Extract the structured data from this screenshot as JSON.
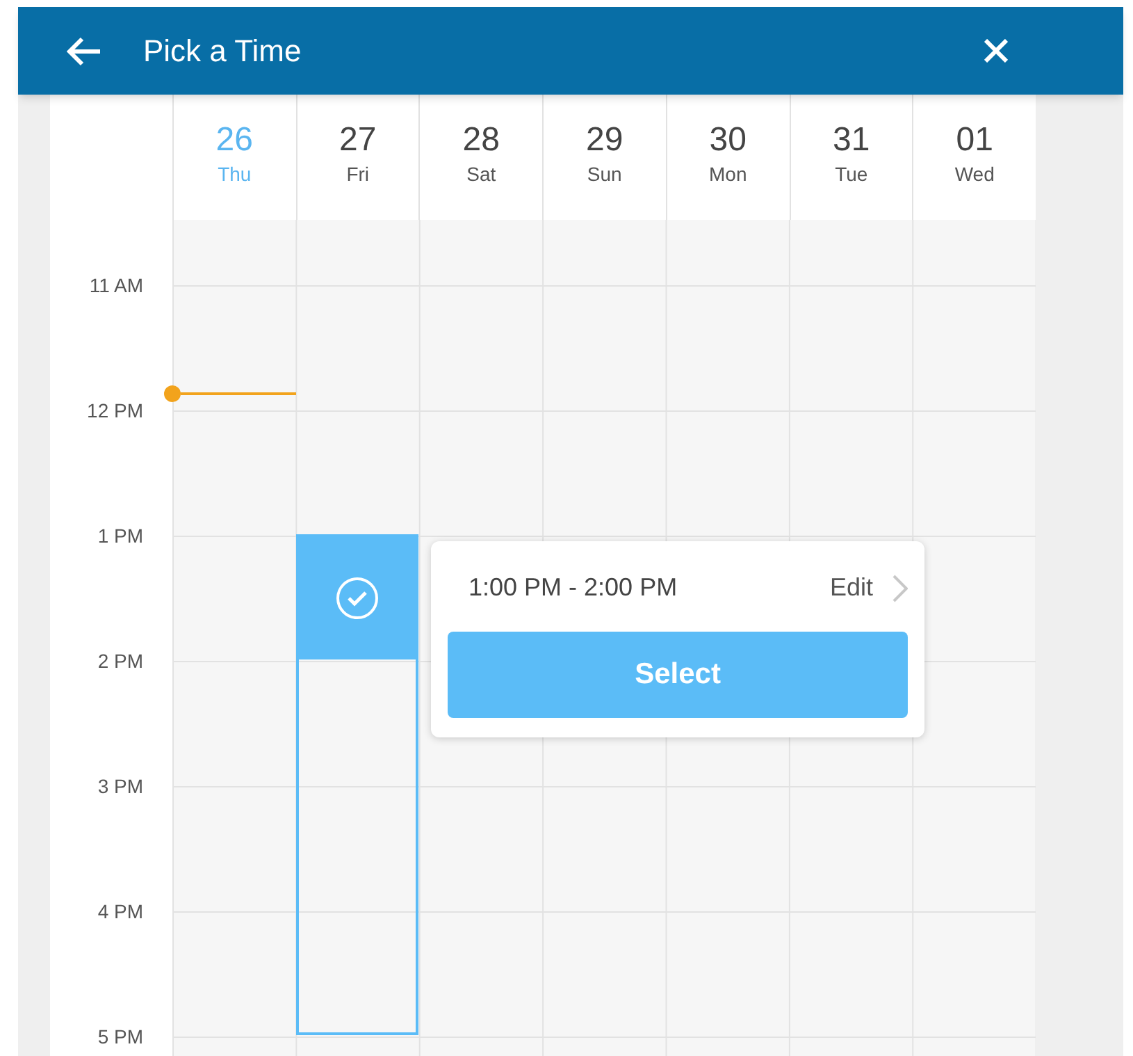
{
  "header": {
    "title": "Pick a Time"
  },
  "days": [
    {
      "date": "26",
      "weekday": "Thu",
      "selected": true
    },
    {
      "date": "27",
      "weekday": "Fri",
      "selected": false
    },
    {
      "date": "28",
      "weekday": "Sat",
      "selected": false
    },
    {
      "date": "29",
      "weekday": "Sun",
      "selected": false
    },
    {
      "date": "30",
      "weekday": "Mon",
      "selected": false
    },
    {
      "date": "31",
      "weekday": "Tue",
      "selected": false
    },
    {
      "date": "01",
      "weekday": "Wed",
      "selected": false
    }
  ],
  "hours": [
    "11 AM",
    "12 PM",
    "1 PM",
    "2 PM",
    "3 PM",
    "4 PM",
    "5 PM"
  ],
  "popup": {
    "time_range": "1:00 PM - 2:00 PM",
    "edit_label": "Edit",
    "button": "Select"
  }
}
